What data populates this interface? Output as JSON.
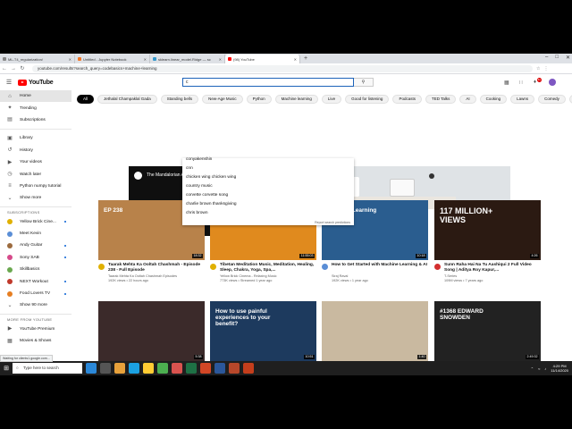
{
  "browser": {
    "tabs": [
      {
        "label": "ML-T4_regularization/",
        "color": "#888888",
        "active": false
      },
      {
        "label": "Untitled - Jupyter Notebook",
        "color": "#f37726",
        "active": false
      },
      {
        "label": "sklearn.linear_model.Ridge — sc",
        "color": "#3499cd",
        "active": false
      },
      {
        "label": "(98) YouTube",
        "color": "#ff0000",
        "active": true
      }
    ],
    "new_tab": "+",
    "url": "youtube.com/results?search_query=codebasics+machine+learning"
  },
  "youtube": {
    "logo_text": "YouTube",
    "search_value": "c",
    "notifications": "9+",
    "sidebar": {
      "main": [
        {
          "label": "Home",
          "icon": "⌂",
          "active": true
        },
        {
          "label": "Trending",
          "icon": "✦",
          "active": false
        },
        {
          "label": "Subscriptions",
          "icon": "▤",
          "active": false
        }
      ],
      "library": [
        {
          "label": "Library",
          "icon": "▣"
        },
        {
          "label": "History",
          "icon": "↺"
        },
        {
          "label": "Your videos",
          "icon": "▶"
        },
        {
          "label": "Watch later",
          "icon": "◷"
        },
        {
          "label": "Python numpy tutorial",
          "icon": "≡"
        },
        {
          "label": "Show more",
          "icon": "⌄"
        }
      ],
      "subscriptions_heading": "SUBSCRIPTIONS",
      "subscriptions": [
        {
          "label": "Yellow Brick Cine...",
          "color": "#e0b000",
          "dot": true
        },
        {
          "label": "Meet Kevin",
          "color": "#5a8ed6",
          "dot": false
        },
        {
          "label": "Andy Guitar",
          "color": "#9c6b3e",
          "dot": true
        },
        {
          "label": "Sony SAB",
          "color": "#d64a8a",
          "dot": true
        },
        {
          "label": "Skillbasics",
          "color": "#6aa84f",
          "dot": false
        },
        {
          "label": "NEXT Workout",
          "color": "#c0392b",
          "dot": true
        },
        {
          "label": "Food Lovers TV",
          "color": "#e67e22",
          "dot": true
        },
        {
          "label": "Show 90 more",
          "color": "",
          "dot": false
        }
      ],
      "more_heading": "MORE FROM YOUTUBE",
      "more": [
        {
          "label": "YouTube Premium",
          "icon": "▶"
        },
        {
          "label": "Movies & Shows",
          "icon": "▦"
        }
      ]
    },
    "chips": [
      "All",
      "Jethalal Champaklal Gada",
      "Standing bells",
      "New-Age Music",
      "Python",
      "Machine learning",
      "Live",
      "Good for listening",
      "Podcasts",
      "TED Talks",
      "AI",
      "Cooking",
      "Lawns",
      "Comedy",
      "Love songs"
    ],
    "promo": {
      "title": "The Mandalorian AR Experience",
      "watermark": "YouTube"
    },
    "suggestions": [
      "conyakenshin",
      "cnn",
      "chicken wing chicken wing",
      "country music",
      "corvette corvette song",
      "charlie brown thanksgiving",
      "chris brown"
    ],
    "suggest_footer": "Report search predictions",
    "videos": [
      {
        "title": "Taarak Mehta Ka Ooltah Chashmah - Episode 238 - Full Episode",
        "channel": "Taarak Mehta Ka Ooltah Chashmah Episodes",
        "meta": "192K views • 22 hours ago",
        "duration": "18:32",
        "bg": "#b8824a",
        "avatar": "#e0b000",
        "overlay": "EP 238"
      },
      {
        "title": "Tibetan Meditation Music, Meditation, Healing, Sleep, Chakra, Yoga, Spa,...",
        "channel": "Yellow Brick Cinema - Relaxing Music",
        "meta": "773K views • Streamed 1 year ago",
        "duration": "11:55:03",
        "bg": "#e08a1e",
        "avatar": "#e0b000",
        "overlay": ""
      },
      {
        "title": "How to Get Started with Machine Learning & AI",
        "channel": "Siraj Raval",
        "meta": "192K views • 1 year ago",
        "duration": "10:18",
        "bg": "#2a5d8f",
        "avatar": "#5a8ed6",
        "overlay": "Machine Learning"
      },
      {
        "title": "Sunn Raha Hai Na Tu Aashiqui 2 Full Video Song | Aditya Roy Kapur,...",
        "channel": "T-Series",
        "meta": "109M views • 7 years ago",
        "duration": "4:26",
        "bg": "#2b1a12",
        "avatar": "#d32f2f",
        "overlay": "117 MILLION+ VIEWS"
      },
      {
        "title": "",
        "channel": "",
        "meta": "",
        "duration": "5:38",
        "bg": "#3b2a2a",
        "avatar": "",
        "overlay": ""
      },
      {
        "title": "",
        "channel": "",
        "meta": "",
        "duration": "10:51",
        "bg": "#1d3a5e",
        "avatar": "",
        "overlay": "How to use painful experiences to your benefit?"
      },
      {
        "title": "",
        "channel": "",
        "meta": "",
        "duration": "1:40",
        "bg": "#c9b9a0",
        "avatar": "",
        "overlay": ""
      },
      {
        "title": "",
        "channel": "",
        "meta": "",
        "duration": "2:49:32",
        "bg": "#222222",
        "avatar": "",
        "overlay": "#1368 EDWARD SNOWDEN"
      }
    ]
  },
  "taskbar": {
    "search_placeholder": "Type here to search",
    "apps": [
      "#2b88d8",
      "#555555",
      "#e7a13b",
      "#1ba1e2",
      "#ffcc33",
      "#4caf50",
      "#d9534f",
      "#1e7145",
      "#d24726",
      "#2b579a",
      "#b7472a",
      "#c43e1c"
    ],
    "time": "4:29 PM",
    "date": "11/14/2020"
  },
  "statusbar": "Waiting for clients1.google.com..."
}
